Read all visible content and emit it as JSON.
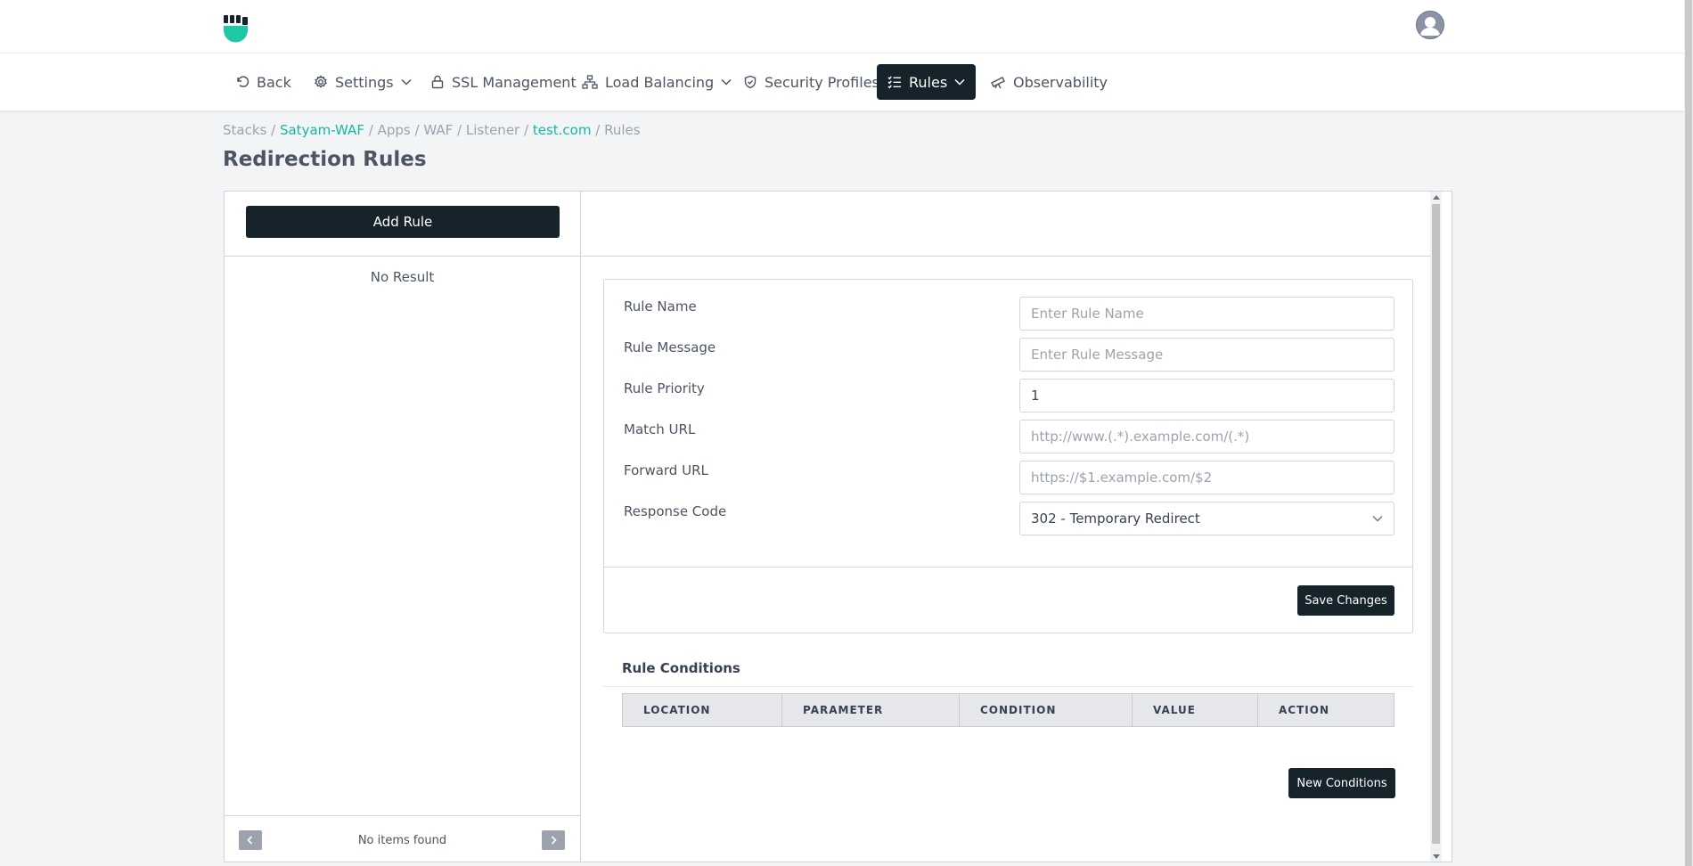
{
  "header": {
    "logo_icon": "fist-logo-icon",
    "avatar_icon": "user-avatar-icon"
  },
  "nav": {
    "items": [
      {
        "label": "Back",
        "icon": "back-icon"
      },
      {
        "label": "Settings",
        "icon": "gear-icon",
        "has_dropdown": true
      },
      {
        "label": "SSL Management",
        "icon": "lock-icon"
      },
      {
        "label": "Load Balancing",
        "icon": "network-icon",
        "has_dropdown": true
      },
      {
        "label": "Security Profiles",
        "icon": "shield-icon"
      },
      {
        "label": "Rules",
        "icon": "list-check-icon",
        "has_dropdown": true,
        "active": true
      },
      {
        "label": "Observability",
        "icon": "telescope-icon"
      }
    ]
  },
  "breadcrumb": {
    "items": [
      "Stacks",
      "Satyam-WAF",
      "Apps",
      "WAF",
      "Listener",
      "test.com",
      "Rules"
    ],
    "separator": "/"
  },
  "page": {
    "title": "Redirection Rules"
  },
  "left_panel": {
    "add_rule_label": "Add Rule",
    "empty_text": "No Result",
    "pager_text": "No items found"
  },
  "form": {
    "fields": [
      {
        "label": "Rule Name",
        "placeholder": "Enter Rule Name",
        "value": ""
      },
      {
        "label": "Rule Message",
        "placeholder": "Enter Rule Message",
        "value": ""
      },
      {
        "label": "Rule Priority",
        "placeholder": "",
        "value": "1"
      },
      {
        "label": "Match URL",
        "placeholder": "http://www.(.*).example.com/(.*)",
        "value": ""
      },
      {
        "label": "Forward URL",
        "placeholder": "https://$1.example.com/$2",
        "value": ""
      },
      {
        "label": "Response Code",
        "selected": "302 - Temporary Redirect"
      }
    ],
    "save_label": "Save Changes"
  },
  "conditions": {
    "title": "Rule Conditions",
    "columns": [
      "LOCATION",
      "PARAMETER",
      "CONDITION",
      "VALUE",
      "ACTION"
    ],
    "new_label": "New Conditions"
  },
  "colors": {
    "accent": "#14b8a6",
    "dark_button": "#17232b"
  }
}
